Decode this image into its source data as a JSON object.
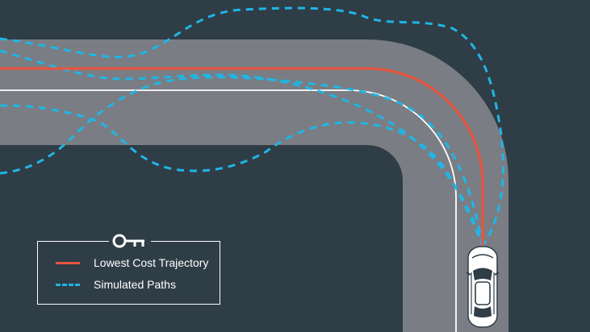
{
  "colors": {
    "background": "#2f3d47",
    "road": "#7a7d83",
    "lane_line": "#ffffff",
    "lowest_cost": "#e8553f",
    "simulated": "#1fb6e6"
  },
  "legend": {
    "icon": "key-icon",
    "items": [
      {
        "label": "Lowest Cost Trajectory",
        "style": "solid",
        "color": "#e8553f"
      },
      {
        "label": "Simulated Paths",
        "style": "dashed",
        "color": "#1fb6e6"
      }
    ]
  },
  "vehicle": {
    "icon": "car-icon",
    "heading": "up"
  }
}
